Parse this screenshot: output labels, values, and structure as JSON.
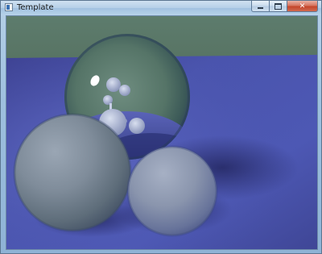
{
  "window": {
    "title": "Template",
    "icons": {
      "app": "application-icon",
      "minimize": "minimize-icon",
      "maximize": "maximize-icon",
      "close": "close-icon"
    },
    "close_glyph": "✕"
  },
  "scene": {
    "description_colors": {
      "wall": "#5e7a6c",
      "floor": "#4c57b0",
      "diffuse_sphere": "#6f7f86",
      "mirror_sphere": "#4e6b62"
    }
  }
}
